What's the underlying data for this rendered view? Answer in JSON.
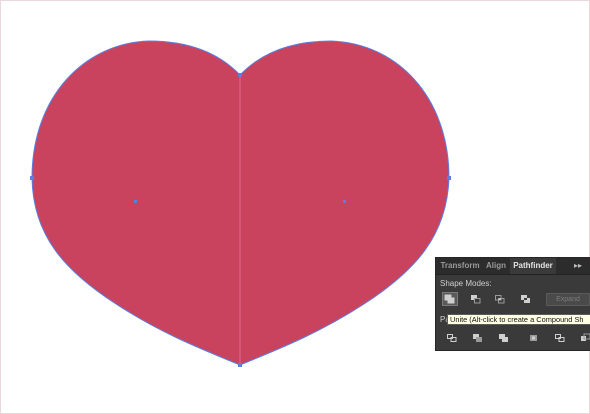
{
  "canvas": {
    "heart_color": "#c9435f",
    "path_color": "#5b7fe0"
  },
  "panel": {
    "tabs": [
      "Transform",
      "Align",
      "Pathfinder"
    ],
    "active_tab": "Pathfinder",
    "menu_label": "▸▸",
    "shape_modes_label": "Shape Modes:",
    "shape_modes": [
      "unite-icon",
      "minus-front-icon",
      "intersect-icon",
      "exclude-icon"
    ],
    "expand_label": "Expand",
    "pathfinders_label": "Pa",
    "pathfinders": [
      "divide-icon",
      "trim-icon",
      "merge-icon",
      "crop-icon",
      "outline-icon",
      "minus-back-icon"
    ],
    "tooltip": "Unite (Alt-click to create a Compound Sh"
  }
}
